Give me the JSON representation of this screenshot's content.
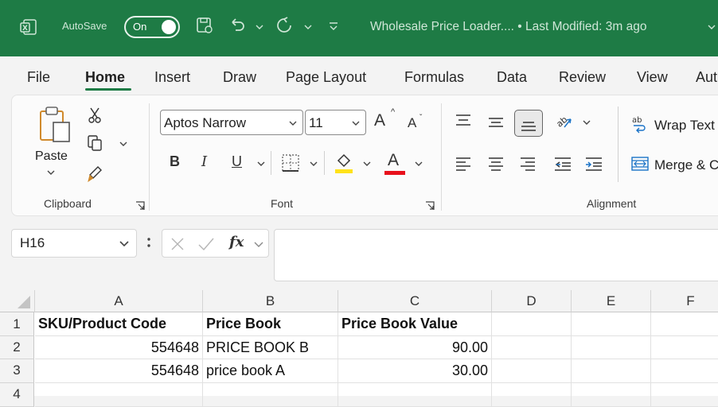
{
  "titlebar": {
    "app_icon": "excel-icon",
    "autosave_label": "AutoSave",
    "autosave_state": "On",
    "title": "Wholesale Price Loader.... • Last Modified: 3m ago",
    "colors": {
      "background": "#1e7b45"
    }
  },
  "menu": {
    "tabs": [
      "File",
      "Home",
      "Insert",
      "Draw",
      "Page Layout",
      "Formulas",
      "Data",
      "Review",
      "View",
      "Aut"
    ],
    "active": "Home"
  },
  "ribbon": {
    "clipboard": {
      "paste_label": "Paste",
      "group_label": "Clipboard"
    },
    "font": {
      "font_name": "Aptos Narrow",
      "font_size": "11",
      "bold": "B",
      "italic": "I",
      "underline": "U",
      "font_color_glyph": "A",
      "grow": "A",
      "shrink": "A",
      "group_label": "Font"
    },
    "alignment": {
      "wrap_text": "Wrap Text",
      "merge": "Merge & C",
      "group_label": "Alignment"
    }
  },
  "formula_bar": {
    "name_box": "H16",
    "fx": "fx",
    "value": ""
  },
  "sheet": {
    "columns": [
      "A",
      "B",
      "C",
      "D",
      "E",
      "F"
    ],
    "rows": [
      "1",
      "2",
      "3",
      "4"
    ],
    "cells": {
      "A1": "SKU/Product Code",
      "B1": "Price Book",
      "C1": "Price Book Value",
      "A2": "554648",
      "B2": "PRICE BOOK B",
      "C2": "90.00",
      "A3": "554648",
      "B3": "price book A",
      "C3": "30.00"
    }
  }
}
